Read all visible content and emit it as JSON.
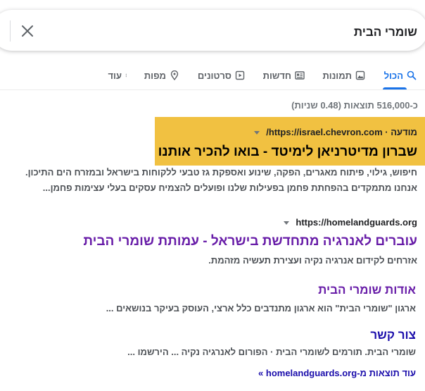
{
  "search": {
    "query": "שומרי הבית"
  },
  "tabs": [
    {
      "label": "הכול",
      "icon": "search-icon",
      "active": true
    },
    {
      "label": "תמונות",
      "icon": "image-icon"
    },
    {
      "label": "חדשות",
      "icon": "news-icon"
    },
    {
      "label": "סרטונים",
      "icon": "video-icon"
    },
    {
      "label": "מפות",
      "icon": "map-pin-icon"
    },
    {
      "label": "עוד",
      "icon": "more-vert-icon"
    }
  ],
  "stats": "כ-516,000 תוצאות (0.48 שניות)",
  "ad": {
    "badge": "מודעה",
    "separator": "·",
    "url": "https://israel.chevron.com/",
    "title": "שברון מדיטרניאן לימיטד - בואו להכיר אותנו",
    "description": "חיפוש, גילוי, פיתוח מאגרים, הפקה, שינוע ואספקת גז טבעי ללקוחות בישראל ובמזרח הים התיכון. אנחנו מתמקדים בהפחתת פחמן בפעילות שלנו ופועלים להצמיח עסקים בעלי עצימות פחמן..."
  },
  "result": {
    "url": "https://homelandguards.org",
    "title": "עוברים לאנרגיה מתחדשת בישראל - עמותת שומרי הבית",
    "snippet": "אזרחים לקידום אנרגיה נקיה ועצירת תעשיה מזהמת.",
    "sitelinks": [
      {
        "title": "אודות שומרי הבית",
        "desc": "ארגון \"שומרי הבית\" הוא ארגון מתנדבים כלל ארצי, העוסק בעיקר בנושאים ..."
      },
      {
        "title": "צור קשר",
        "desc": "שומרי הבית. תורמים לשומרי הבית · הפורום לאנרגיה נקיה ... הירשמו ..."
      }
    ],
    "more": "עוד תוצאות מ-homelandguards.org »"
  },
  "colors": {
    "accent": "#1a73e8",
    "ad_highlight": "#f1c141",
    "visited": "#681da8",
    "link": "#1a0dab"
  }
}
